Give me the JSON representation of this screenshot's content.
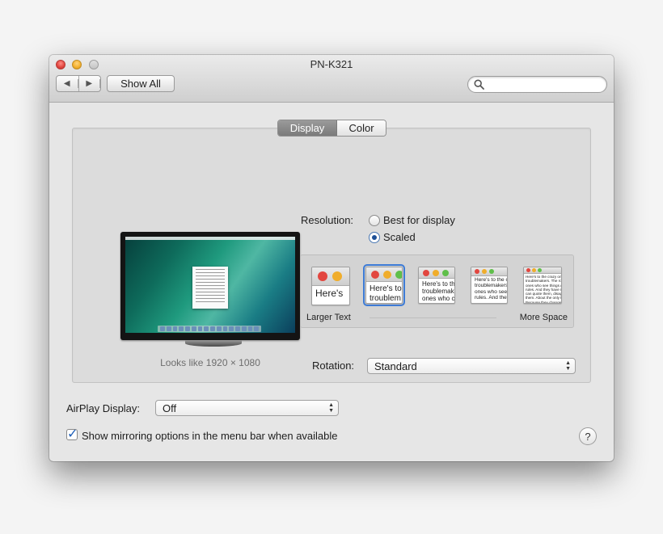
{
  "window": {
    "title": "PN-K321"
  },
  "toolbar": {
    "back_icon": "chevron-left-icon",
    "forward_icon": "chevron-right-icon",
    "show_all_label": "Show All",
    "search_placeholder": ""
  },
  "tabs": [
    {
      "label": "Display",
      "selected": true
    },
    {
      "label": "Color",
      "selected": false
    }
  ],
  "display": {
    "looks_like": "Looks like 1920 × 1080",
    "resolution_label": "Resolution:",
    "resolution_options": [
      {
        "label": "Best for display",
        "selected": false
      },
      {
        "label": "Scaled",
        "selected": true
      }
    ],
    "scale": {
      "left_label": "Larger Text",
      "right_label": "More Space",
      "selected_index": 1,
      "thumbs": [
        {
          "text": "Here's"
        },
        {
          "text": "Here's to\ntroublem"
        },
        {
          "text": "Here's to th\ntroublemak\nones who c"
        },
        {
          "text": "Here's to the c\ntroublemakers.\nones who see t\nrules. And they"
        },
        {
          "text": "Here's to the crazy one\ntroublemakers. The rou\nones who see things dif\nrules. And they have no\ncan quote them, disagr\nthem. About the only th\nBecause they change th"
        }
      ]
    },
    "rotation_label": "Rotation:",
    "rotation_value": "Standard"
  },
  "airplay": {
    "label": "AirPlay Display:",
    "value": "Off"
  },
  "mirroring": {
    "label": "Show mirroring options in the menu bar when available",
    "checked": true
  },
  "help_label": "?"
}
